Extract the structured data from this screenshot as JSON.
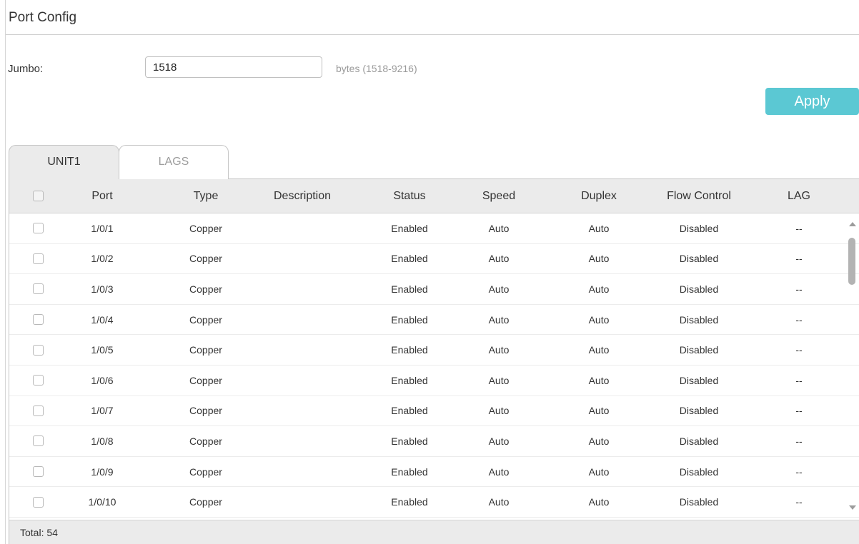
{
  "section": {
    "title": "Port Config"
  },
  "jumbo": {
    "label": "Jumbo:",
    "value": "1518",
    "hint": "bytes (1518-9216)"
  },
  "apply_label": "Apply",
  "tabs": [
    {
      "label": "UNIT1",
      "active": true
    },
    {
      "label": "LAGS",
      "active": false
    }
  ],
  "table": {
    "columns": [
      "Port",
      "Type",
      "Description",
      "Status",
      "Speed",
      "Duplex",
      "Flow Control",
      "LAG"
    ],
    "rows": [
      {
        "port": "1/0/1",
        "type": "Copper",
        "description": "",
        "status": "Enabled",
        "speed": "Auto",
        "duplex": "Auto",
        "flow_control": "Disabled",
        "lag": "--"
      },
      {
        "port": "1/0/2",
        "type": "Copper",
        "description": "",
        "status": "Enabled",
        "speed": "Auto",
        "duplex": "Auto",
        "flow_control": "Disabled",
        "lag": "--"
      },
      {
        "port": "1/0/3",
        "type": "Copper",
        "description": "",
        "status": "Enabled",
        "speed": "Auto",
        "duplex": "Auto",
        "flow_control": "Disabled",
        "lag": "--"
      },
      {
        "port": "1/0/4",
        "type": "Copper",
        "description": "",
        "status": "Enabled",
        "speed": "Auto",
        "duplex": "Auto",
        "flow_control": "Disabled",
        "lag": "--"
      },
      {
        "port": "1/0/5",
        "type": "Copper",
        "description": "",
        "status": "Enabled",
        "speed": "Auto",
        "duplex": "Auto",
        "flow_control": "Disabled",
        "lag": "--"
      },
      {
        "port": "1/0/6",
        "type": "Copper",
        "description": "",
        "status": "Enabled",
        "speed": "Auto",
        "duplex": "Auto",
        "flow_control": "Disabled",
        "lag": "--"
      },
      {
        "port": "1/0/7",
        "type": "Copper",
        "description": "",
        "status": "Enabled",
        "speed": "Auto",
        "duplex": "Auto",
        "flow_control": "Disabled",
        "lag": "--"
      },
      {
        "port": "1/0/8",
        "type": "Copper",
        "description": "",
        "status": "Enabled",
        "speed": "Auto",
        "duplex": "Auto",
        "flow_control": "Disabled",
        "lag": "--"
      },
      {
        "port": "1/0/9",
        "type": "Copper",
        "description": "",
        "status": "Enabled",
        "speed": "Auto",
        "duplex": "Auto",
        "flow_control": "Disabled",
        "lag": "--"
      },
      {
        "port": "1/0/10",
        "type": "Copper",
        "description": "",
        "status": "Enabled",
        "speed": "Auto",
        "duplex": "Auto",
        "flow_control": "Disabled",
        "lag": "--"
      }
    ],
    "total": "Total: 54"
  },
  "colors": {
    "accent": "#5bc8d3",
    "header_bg": "#ebebeb",
    "border": "#c6c6c6"
  },
  "icons": {
    "scroll_up": "triangle-up-icon",
    "scroll_down": "triangle-down-icon"
  }
}
